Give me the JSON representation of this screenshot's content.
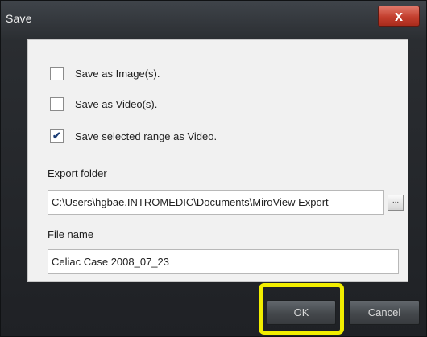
{
  "window": {
    "title": "Save",
    "close_label": "x"
  },
  "options": [
    {
      "label": "Save as Image(s).",
      "checked": false
    },
    {
      "label": "Save as Video(s).",
      "checked": false
    },
    {
      "label": "Save selected range as Video.",
      "checked": true
    }
  ],
  "checkmark": "✔",
  "export_folder": {
    "label": "Export folder",
    "value": "C:\\Users\\hgbae.INTROMEDIC\\Documents\\MiroView Export",
    "browse_label": "..."
  },
  "file_name": {
    "label": "File name",
    "value": "Celiac Case 2008_07_23"
  },
  "buttons": {
    "ok": "OK",
    "cancel": "Cancel"
  },
  "annotation": {
    "highlight_color": "#f2ee00",
    "highlight_target": "ok-button"
  }
}
